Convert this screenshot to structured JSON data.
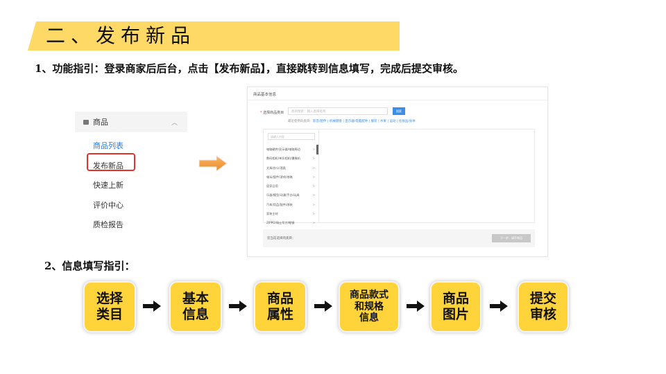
{
  "section_title": "二、发布新品",
  "guide_1": "1、功能指引：登录商家后后台，点击【发布新品】，直接跳转到信息填写，完成后提交审核。",
  "guide_2": "2、信息填写指引：",
  "sidebar": {
    "header": "商品",
    "items": [
      {
        "label": "商品列表"
      },
      {
        "label": "发布新品"
      },
      {
        "label": "快速上新"
      },
      {
        "label": "评价中心"
      },
      {
        "label": "质检报告"
      }
    ]
  },
  "form_screenshot": {
    "title": "商品基本信息",
    "category_label": "选择商品类目",
    "search_placeholder": "类目搜索：输入类目名称",
    "search_button": "搜索",
    "recent_prefix": "最近使用的类目：",
    "recent_links": "影音/配件 | 机械键盘 | 显示器/电脑配件 | 服装 | 水果 | 运动 | 化妆品/身体",
    "column_search_placeholder": "请输入内容",
    "categories": [
      "电脑硬件/显示器/电脑周边",
      "数码相机/单反相机/摄像机",
      "文具/办公/酒类",
      "电玩/配件/游戏/攻略",
      "居家日用",
      "乐器/模型/动漫/手办/玩具",
      "汽车/用品/配件/改装",
      "家装主材",
      "ZIPPO/瑞士军刀/眼镜"
    ],
    "selected_prefix": "您当前选择的类目：",
    "next_button": "下一步，填写商品"
  },
  "flow_steps": [
    {
      "label": "选择\n类目"
    },
    {
      "label": "基本\n信息"
    },
    {
      "label": "商品\n属性"
    },
    {
      "label": "商品款式\n和规格\n信息"
    },
    {
      "label": "商品\n图片"
    },
    {
      "label": "提交\n审核"
    }
  ],
  "colors": {
    "banner": "#ffd966",
    "step_fill": "#ffd43b",
    "highlight": "#e0312b",
    "arrow_orange": "#f39a3b",
    "link_blue": "#2d7be5"
  }
}
